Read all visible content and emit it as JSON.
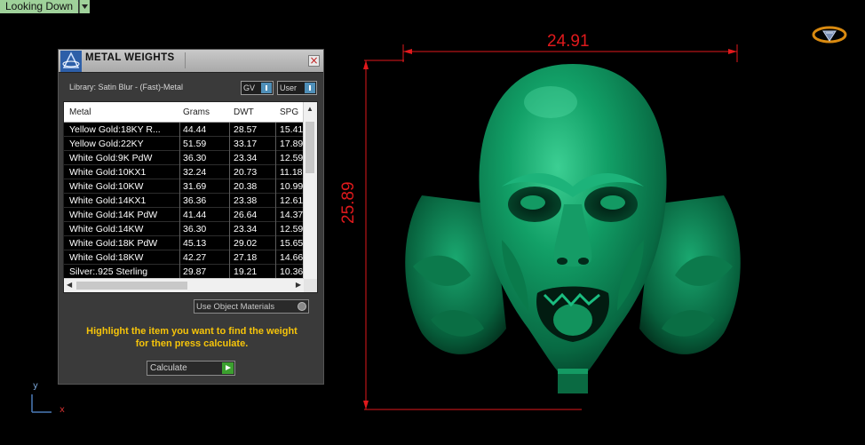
{
  "viewport": {
    "label": "Looking Down",
    "dim_width": "24.91",
    "dim_height": "25.89",
    "axis_y": "y",
    "axis_x": "x",
    "model": "green-sculpted-face-pendant"
  },
  "dialog": {
    "title": "METAL WEIGHTS",
    "library_label": "Library: Satin Blur - (Fast)-Metal",
    "gv_dropdown": "GV",
    "user_dropdown": "User",
    "columns": [
      "Metal",
      "Grams",
      "DWT",
      "SPG"
    ],
    "rows": [
      [
        "Yellow Gold:18KY R...",
        "44.44",
        "28.57",
        "15.41"
      ],
      [
        "Yellow Gold:22KY",
        "51.59",
        "33.17",
        "17.89"
      ],
      [
        "White Gold:9K PdW",
        "36.30",
        "23.34",
        "12.59"
      ],
      [
        "White Gold:10KX1",
        "32.24",
        "20.73",
        "11.18"
      ],
      [
        "White Gold:10KW",
        "31.69",
        "20.38",
        "10.99"
      ],
      [
        "White Gold:14KX1",
        "36.36",
        "23.38",
        "12.61"
      ],
      [
        "White Gold:14K PdW",
        "41.44",
        "26.64",
        "14.37"
      ],
      [
        "White Gold:14KW",
        "36.30",
        "23.34",
        "12.59"
      ],
      [
        "White Gold:18K PdW",
        "45.13",
        "29.02",
        "15.65"
      ],
      [
        "White Gold:18KW",
        "42.27",
        "27.18",
        "14.66"
      ],
      [
        "Silver:.925 Sterling",
        "29.87",
        "19.21",
        "10.36"
      ]
    ],
    "use_object_materials": "Use Object Materials",
    "hint_line1": "Highlight the item you want to find the weight",
    "hint_line2": "for then press calculate.",
    "calculate_label": "Calculate"
  },
  "colors": {
    "dimension_red": "#e0191c",
    "model_green": "#0f8f5a",
    "hint_yellow": "#f6c40a",
    "view_tab_green": "#9fd19a"
  }
}
